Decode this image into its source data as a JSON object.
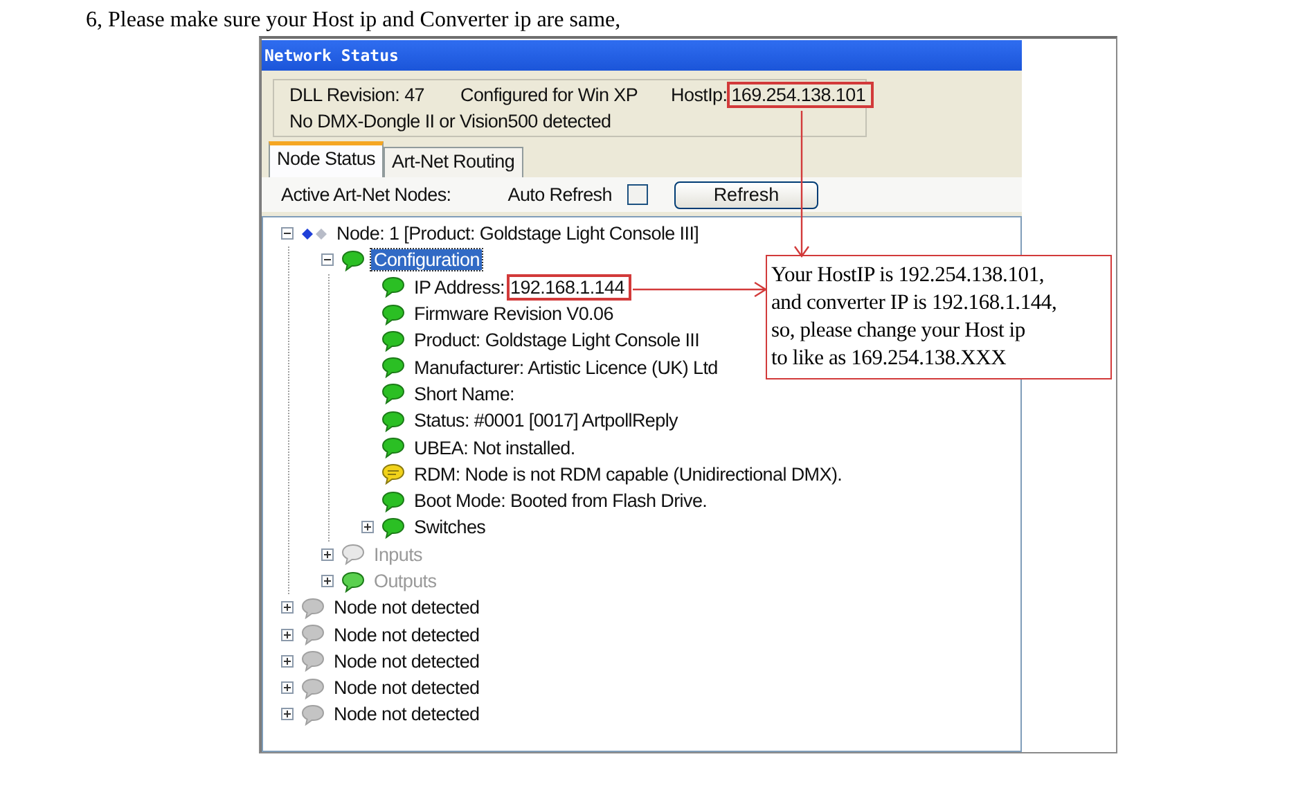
{
  "heading": "6, Please make sure your Host ip and Converter ip are same,",
  "window": {
    "title": "Network Status"
  },
  "info": {
    "dll": "DLL Revision: 47",
    "configured": "Configured for Win XP",
    "host_label": "HostIp:",
    "host_ip": "169.254.138.101",
    "dongle": "No DMX-Dongle II or Vision500 detected"
  },
  "tabs": [
    {
      "label": "Node Status",
      "selected": true
    },
    {
      "label": "Art-Net Routing",
      "selected": false
    }
  ],
  "toolbar": {
    "nodes_label": "Active Art-Net Nodes:",
    "auto_refresh": {
      "label": "Auto Refresh",
      "checked": false
    },
    "refresh_button": "Refresh"
  },
  "tree": [
    {
      "kind": "node",
      "label": "Node: 1   [Product: Goldstage Light Console III]",
      "expanded": true,
      "children": [
        {
          "kind": "ok",
          "label": "Configuration",
          "selected": true,
          "expanded": true,
          "children": [
            {
              "kind": "ok",
              "label": "IP Address:",
              "value": "192.168.1.144",
              "selected": false
            },
            {
              "kind": "ok",
              "label": "Firmware Revision V0.06",
              "selected": false
            },
            {
              "kind": "ok",
              "label": "Product: Goldstage Light Console III",
              "selected": false
            },
            {
              "kind": "ok",
              "label": "Manufacturer: Artistic Licence (UK) Ltd",
              "selected": false
            },
            {
              "kind": "ok",
              "label": "Short Name:",
              "selected": false
            },
            {
              "kind": "ok",
              "label": "Status: #0001 [0017] ArtpollReply",
              "selected": false
            },
            {
              "kind": "ok",
              "label": "UBEA: Not installed.",
              "selected": false
            },
            {
              "kind": "warning",
              "label": "RDM: Node is not RDM capable (Unidirectional DMX).",
              "selected": false
            },
            {
              "kind": "ok",
              "label": "Boot Mode: Booted from Flash Drive.",
              "selected": false
            },
            {
              "kind": "ok",
              "label": "Switches",
              "selected": false,
              "expanded": false
            }
          ]
        },
        {
          "kind": "faded",
          "label": "Inputs",
          "selected": false,
          "expanded": false
        },
        {
          "kind": "faded-ok",
          "label": "Outputs",
          "selected": false,
          "expanded": false
        }
      ]
    },
    {
      "kind": "none",
      "label": "Node not detected",
      "expanded": false
    },
    {
      "kind": "none",
      "label": "Node not detected",
      "expanded": false
    },
    {
      "kind": "none",
      "label": "Node not detected",
      "expanded": false
    },
    {
      "kind": "none",
      "label": "Node not detected",
      "expanded": false
    },
    {
      "kind": "none",
      "label": "Node not detected",
      "expanded": false
    }
  ],
  "callout": {
    "lines": [
      "Your HostIP is 192.254.138.101,",
      "and converter IP is 192.168.1.144,",
      "so, please change your Host ip",
      "to like as 169.254.138.XXX"
    ]
  }
}
